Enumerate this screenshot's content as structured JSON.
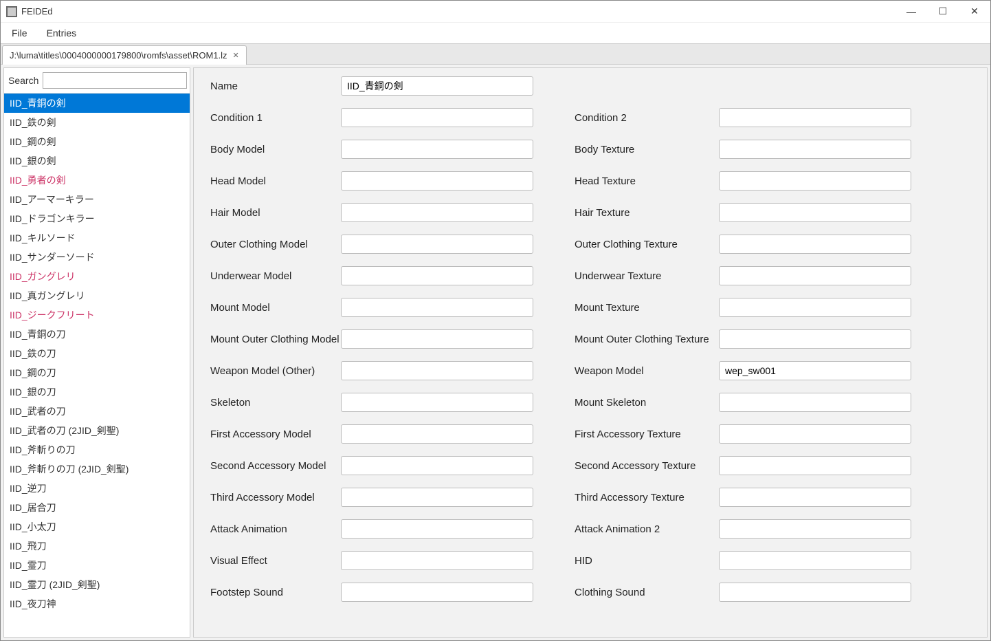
{
  "window": {
    "title": "FEIDEd"
  },
  "menu": {
    "file": "File",
    "entries": "Entries"
  },
  "tab": {
    "label": "J:\\luma\\titles\\0004000000179800\\romfs\\asset\\ROM1.lz"
  },
  "sidebar": {
    "search_label": "Search",
    "search_value": "",
    "items": [
      {
        "label": "IID_青銅の剣",
        "selected": true
      },
      {
        "label": "IID_鉄の剣"
      },
      {
        "label": "IID_鋼の剣"
      },
      {
        "label": "IID_銀の剣"
      },
      {
        "label": "IID_勇者の剣",
        "highlight": true
      },
      {
        "label": "IID_アーマーキラー"
      },
      {
        "label": "IID_ドラゴンキラー"
      },
      {
        "label": "IID_キルソード"
      },
      {
        "label": "IID_サンダーソード"
      },
      {
        "label": "IID_ガングレリ",
        "highlight": true
      },
      {
        "label": "IID_真ガングレリ"
      },
      {
        "label": "IID_ジークフリート",
        "highlight": true
      },
      {
        "label": "IID_青銅の刀"
      },
      {
        "label": "IID_鉄の刀"
      },
      {
        "label": "IID_鋼の刀"
      },
      {
        "label": "IID_銀の刀"
      },
      {
        "label": "IID_武者の刀"
      },
      {
        "label": "IID_武者の刀 (2JID_剣聖)"
      },
      {
        "label": "IID_斧斬りの刀"
      },
      {
        "label": "IID_斧斬りの刀 (2JID_剣聖)"
      },
      {
        "label": "IID_逆刀"
      },
      {
        "label": "IID_居合刀"
      },
      {
        "label": "IID_小太刀"
      },
      {
        "label": "IID_飛刀"
      },
      {
        "label": "IID_霊刀"
      },
      {
        "label": "IID_霊刀 (2JID_剣聖)"
      },
      {
        "label": "IID_夜刀神"
      }
    ]
  },
  "form": {
    "name": {
      "label": "Name",
      "value": "IID_青銅の剣"
    },
    "condition1": {
      "label": "Condition 1",
      "value": ""
    },
    "condition2": {
      "label": "Condition 2",
      "value": ""
    },
    "body_model": {
      "label": "Body Model",
      "value": ""
    },
    "body_texture": {
      "label": "Body Texture",
      "value": ""
    },
    "head_model": {
      "label": "Head Model",
      "value": ""
    },
    "head_texture": {
      "label": "Head Texture",
      "value": ""
    },
    "hair_model": {
      "label": "Hair Model",
      "value": ""
    },
    "hair_texture": {
      "label": "Hair Texture",
      "value": ""
    },
    "outer_clothing_model": {
      "label": "Outer Clothing Model",
      "value": ""
    },
    "outer_clothing_texture": {
      "label": "Outer Clothing Texture",
      "value": ""
    },
    "underwear_model": {
      "label": "Underwear Model",
      "value": ""
    },
    "underwear_texture": {
      "label": "Underwear Texture",
      "value": ""
    },
    "mount_model": {
      "label": "Mount Model",
      "value": ""
    },
    "mount_texture": {
      "label": "Mount Texture",
      "value": ""
    },
    "mount_outer_clothing_model": {
      "label": "Mount Outer Clothing Model",
      "value": ""
    },
    "mount_outer_clothing_texture": {
      "label": "Mount Outer Clothing Texture",
      "value": ""
    },
    "weapon_model_other": {
      "label": "Weapon Model (Other)",
      "value": ""
    },
    "weapon_model": {
      "label": "Weapon Model",
      "value": "wep_sw001"
    },
    "skeleton": {
      "label": "Skeleton",
      "value": ""
    },
    "mount_skeleton": {
      "label": "Mount Skeleton",
      "value": ""
    },
    "first_accessory_model": {
      "label": "First Accessory Model",
      "value": ""
    },
    "first_accessory_texture": {
      "label": "First Accessory Texture",
      "value": ""
    },
    "second_accessory_model": {
      "label": "Second Accessory Model",
      "value": ""
    },
    "second_accessory_texture": {
      "label": "Second Accessory Texture",
      "value": ""
    },
    "third_accessory_model": {
      "label": "Third Accessory Model",
      "value": ""
    },
    "third_accessory_texture": {
      "label": "Third Accessory Texture",
      "value": ""
    },
    "attack_animation": {
      "label": "Attack Animation",
      "value": ""
    },
    "attack_animation_2": {
      "label": "Attack Animation 2",
      "value": ""
    },
    "visual_effect": {
      "label": "Visual Effect",
      "value": ""
    },
    "hid": {
      "label": "HID",
      "value": ""
    },
    "footstep_sound": {
      "label": "Footstep Sound",
      "value": ""
    },
    "clothing_sound": {
      "label": "Clothing Sound",
      "value": ""
    }
  }
}
